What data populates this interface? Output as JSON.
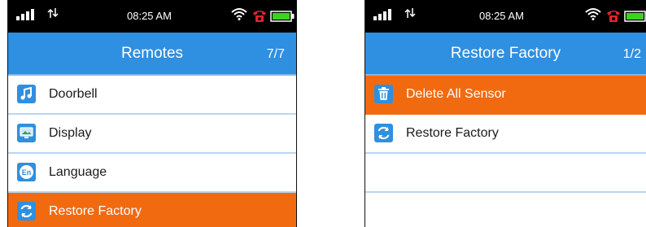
{
  "left_screen": {
    "status": {
      "time": "08:25 AM"
    },
    "header": {
      "title": "Remotes",
      "page": "7/7"
    },
    "items": [
      {
        "label": "Doorbell",
        "icon": "music-note-icon"
      },
      {
        "label": "Display",
        "icon": "display-icon"
      },
      {
        "label": "Language",
        "icon": "language-icon"
      },
      {
        "label": "Restore Factory",
        "icon": "refresh-icon",
        "selected": true
      }
    ]
  },
  "right_screen": {
    "status": {
      "time": "08:25 AM"
    },
    "header": {
      "title": "Restore Factory",
      "page": "1/2"
    },
    "items": [
      {
        "label": "Delete All Sensor",
        "icon": "trash-icon",
        "selected": true
      },
      {
        "label": "Restore Factory",
        "icon": "refresh-icon"
      },
      {
        "label": "",
        "icon": ""
      },
      {
        "label": "",
        "icon": ""
      }
    ]
  },
  "colors": {
    "accent_blue": "#2f8fe0",
    "selected_orange": "#f26a10",
    "status_bar": "#000000"
  },
  "icons": {
    "language_glyph": "En"
  }
}
